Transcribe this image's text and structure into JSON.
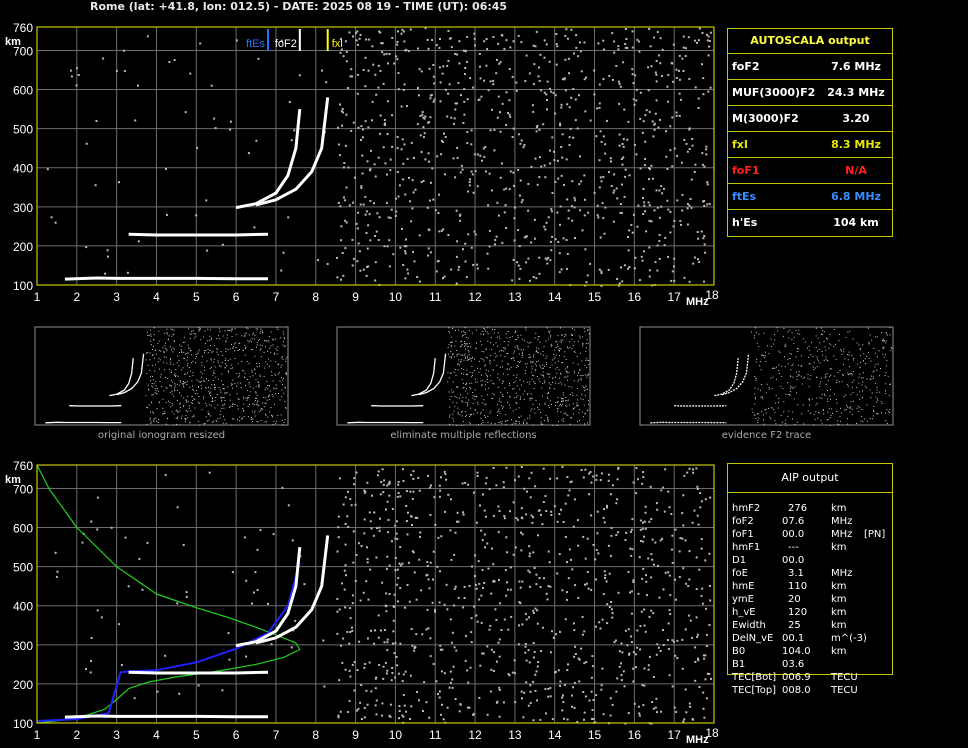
{
  "header": "Rome (lat: +41.8, lon: 012.5) - DATE: 2025 08 19 - TIME (UT): 06:45",
  "colors": {
    "frame": "#c8c800",
    "grid": "#909090",
    "fxl": "#ffff00",
    "ftEs": "#1e78ff",
    "foF1": "#ff2020",
    "green_profile": "#20d020",
    "blue_profile": "#2020ff"
  },
  "chart_data": [
    {
      "type": "scatter",
      "title": "",
      "xlabel": "MHz",
      "ylabel": "km",
      "xlim": [
        1,
        18
      ],
      "ylim": [
        100,
        760
      ],
      "x_ticks": [
        "1",
        "2",
        "3",
        "4",
        "5",
        "6",
        "7",
        "8",
        "9",
        "10",
        "11",
        "12",
        "13",
        "14",
        "15",
        "16",
        "17",
        "18"
      ],
      "y_ticks": [
        "100",
        "200",
        "300",
        "400",
        "500",
        "600",
        "700",
        "760"
      ],
      "grid": true,
      "markers": [
        {
          "label": "ftEs",
          "x": 6.8,
          "color": "#1e78ff"
        },
        {
          "label": "foF2",
          "x": 7.6,
          "color": "#ffffff"
        },
        {
          "label": "fxl",
          "x": 8.3,
          "color": "#ffff00"
        }
      ],
      "series": [
        {
          "x": [
            1.7,
            2.5,
            3.0,
            4.0,
            5.0,
            6.0,
            6.8
          ],
          "y": [
            115,
            118,
            117,
            117,
            117,
            116,
            116
          ]
        },
        {
          "x": [
            3.3,
            4.0,
            5.0,
            6.0,
            6.8
          ],
          "y": [
            230,
            228,
            228,
            228,
            230
          ]
        },
        {
          "x": [
            6.0,
            6.5,
            7.0,
            7.3,
            7.5,
            7.6
          ],
          "y": [
            298,
            308,
            335,
            380,
            450,
            550
          ]
        },
        {
          "x": [
            6.5,
            7.0,
            7.5,
            7.9,
            8.15,
            8.3
          ],
          "y": [
            305,
            318,
            345,
            390,
            450,
            580
          ]
        }
      ]
    },
    {
      "type": "scatter",
      "title": "",
      "xlabel": "MHz",
      "ylabel": "km",
      "xlim": [
        1,
        18
      ],
      "ylim": [
        100,
        760
      ],
      "x_ticks": [
        "1",
        "2",
        "3",
        "4",
        "5",
        "6",
        "7",
        "8",
        "9",
        "10",
        "11",
        "12",
        "13",
        "14",
        "15",
        "16",
        "17",
        "18"
      ],
      "y_ticks": [
        "100",
        "200",
        "300",
        "400",
        "500",
        "600",
        "700",
        "760"
      ],
      "grid": true,
      "series": [
        {
          "x": [
            1.0,
            1.3,
            2.0,
            3.0,
            4.0,
            5.0,
            5.8,
            6.5,
            7.0,
            7.5,
            7.6,
            7.2,
            6.5,
            5.5,
            4.5,
            3.8,
            3.3,
            3.0,
            2.7,
            2.0,
            1.3,
            1.0
          ],
          "y": [
            760,
            700,
            600,
            500,
            430,
            395,
            370,
            345,
            325,
            305,
            288,
            268,
            250,
            232,
            218,
            205,
            188,
            160,
            135,
            112,
            103,
            100
          ]
        },
        {
          "x": [
            1.0,
            2.0,
            2.8,
            3.1,
            3.3,
            4.0,
            5.0,
            6.0,
            6.8,
            7.3,
            7.6
          ],
          "y": [
            105,
            110,
            125,
            230,
            232,
            235,
            255,
            290,
            330,
            400,
            510
          ]
        },
        {
          "x": [
            1.7,
            2.5,
            3.0,
            4.0,
            5.0,
            6.0,
            6.8
          ],
          "y": [
            115,
            118,
            117,
            117,
            117,
            116,
            116
          ]
        },
        {
          "x": [
            3.3,
            4.0,
            5.0,
            6.0,
            6.8
          ],
          "y": [
            230,
            228,
            228,
            228,
            230
          ]
        },
        {
          "x": [
            6.0,
            6.5,
            7.0,
            7.3,
            7.5,
            7.6
          ],
          "y": [
            298,
            308,
            335,
            380,
            450,
            550
          ]
        },
        {
          "x": [
            6.5,
            7.0,
            7.5,
            7.9,
            8.15,
            8.3
          ],
          "y": [
            305,
            318,
            345,
            390,
            450,
            580
          ]
        }
      ]
    }
  ],
  "autoscala": {
    "title": "AUTOSCALA output",
    "rows": [
      {
        "label": "foF2",
        "value": "7.6 MHz",
        "color": "#ffffff"
      },
      {
        "label": "MUF(3000)F2",
        "value": "24.3 MHz",
        "color": "#ffffff"
      },
      {
        "label": "M(3000)F2",
        "value": "3.20",
        "color": "#ffffff"
      },
      {
        "label": "fxI",
        "value": "8.3 MHz",
        "color": "#e8e800"
      },
      {
        "label": "foF1",
        "value": "N/A",
        "color": "#ff2020"
      },
      {
        "label": "ftEs",
        "value": "6.8 MHz",
        "color": "#3a8cff"
      },
      {
        "label": "h'Es",
        "value": "104     km",
        "color": "#ffffff"
      }
    ]
  },
  "thumbnails": [
    {
      "caption": "original ionogram resized"
    },
    {
      "caption": "eliminate multiple reflections"
    },
    {
      "caption": "evidence F2 trace"
    }
  ],
  "aip": {
    "title": "AIP output",
    "rows": [
      {
        "label": "hmF2",
        "value": "276",
        "unit": "km",
        "extra": ""
      },
      {
        "label": "foF2",
        "value": "07.6",
        "unit": "MHz",
        "extra": ""
      },
      {
        "label": "foF1",
        "value": "00.0",
        "unit": "MHz",
        "extra": "[PN]"
      },
      {
        "label": "hmF1",
        "value": "---",
        "unit": "km",
        "extra": ""
      },
      {
        "label": "D1",
        "value": "00.0",
        "unit": "",
        "extra": ""
      },
      {
        "label": "foE",
        "value": "3.1",
        "unit": "MHz",
        "extra": ""
      },
      {
        "label": "hmE",
        "value": "110",
        "unit": "km",
        "extra": ""
      },
      {
        "label": "ymE",
        "value": "20",
        "unit": "km",
        "extra": ""
      },
      {
        "label": "h_vE",
        "value": "120",
        "unit": "km",
        "extra": ""
      },
      {
        "label": "Ewidth",
        "value": "25",
        "unit": "km",
        "extra": ""
      },
      {
        "label": "DelN_vE",
        "value": "00.1",
        "unit": "m^(-3)",
        "extra": ""
      },
      {
        "label": "B0",
        "value": "104.0",
        "unit": "km",
        "extra": ""
      },
      {
        "label": "B1",
        "value": "03.6",
        "unit": "",
        "extra": ""
      },
      {
        "label": "TEC[Bot]",
        "value": "006.9",
        "unit": "TECU",
        "extra": ""
      },
      {
        "label": "TEC[Top]",
        "value": "008.0",
        "unit": "TECU",
        "extra": ""
      }
    ]
  }
}
